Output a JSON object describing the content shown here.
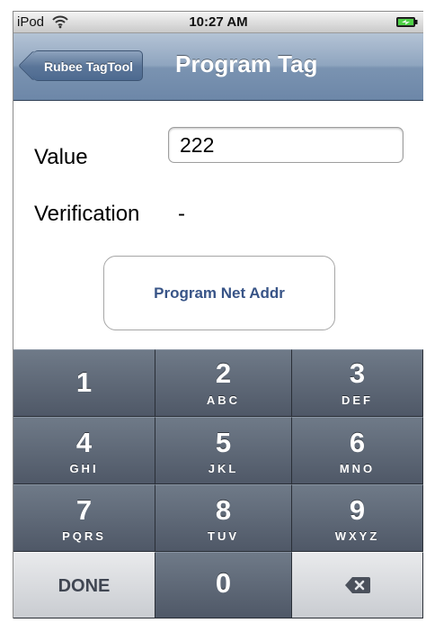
{
  "status_bar": {
    "carrier": "iPod",
    "time": "10:27 AM",
    "wifi_icon": "wifi-icon",
    "battery_icon": "battery-charging-icon"
  },
  "nav_bar": {
    "back_label": "Rubee TagTool",
    "title": "Program Tag"
  },
  "form": {
    "value_label": "Value",
    "value": "222",
    "verification_label": "Verification",
    "verification_value": "-",
    "program_button_label": "Program Net Addr"
  },
  "keypad": {
    "keys": [
      {
        "digit": "1",
        "letters": ""
      },
      {
        "digit": "2",
        "letters": "ABC"
      },
      {
        "digit": "3",
        "letters": "DEF"
      },
      {
        "digit": "4",
        "letters": "GHI"
      },
      {
        "digit": "5",
        "letters": "JKL"
      },
      {
        "digit": "6",
        "letters": "MNO"
      },
      {
        "digit": "7",
        "letters": "PQRS"
      },
      {
        "digit": "8",
        "letters": "TUV"
      },
      {
        "digit": "9",
        "letters": "WXYZ"
      }
    ],
    "done_label": "DONE",
    "zero_digit": "0",
    "delete_icon": "backspace-icon"
  },
  "colors": {
    "nav_bar": "#7a93b1",
    "button_text": "#385487",
    "key_dark": "#5b6573",
    "key_light": "#d9dbdf"
  }
}
